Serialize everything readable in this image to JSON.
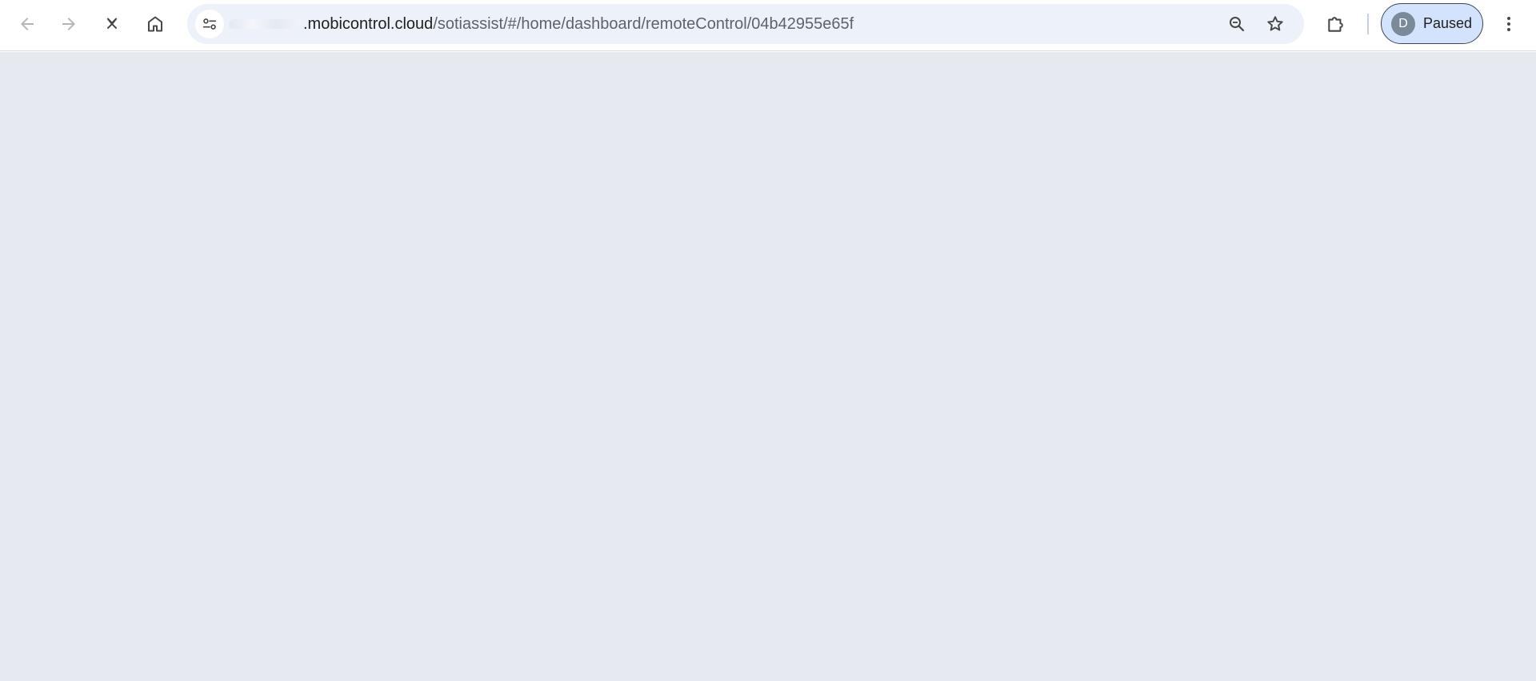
{
  "toolbar": {
    "back_icon": "arrow-left-icon",
    "forward_icon": "arrow-right-icon",
    "stop_icon": "close-icon",
    "home_icon": "home-icon",
    "site_info_icon": "tune-icon",
    "zoom_icon": "zoom-out-icon",
    "bookmark_icon": "star-icon",
    "extensions_icon": "puzzle-icon",
    "menu_icon": "more-vert-icon"
  },
  "omnibox": {
    "domain": ".mobicontrol.cloud",
    "path": "/sotiassist/#/home/dashboard/remoteControl/04b42955e65f"
  },
  "profile": {
    "initial": "D",
    "status": "Paused"
  },
  "colors": {
    "toolbar_bg": "#ffffff",
    "omnibox_bg": "#edf2fa",
    "profile_bg": "#d3e3fd",
    "avatar_bg": "#7a8a9b",
    "content_bg": "#e6e9ef"
  }
}
